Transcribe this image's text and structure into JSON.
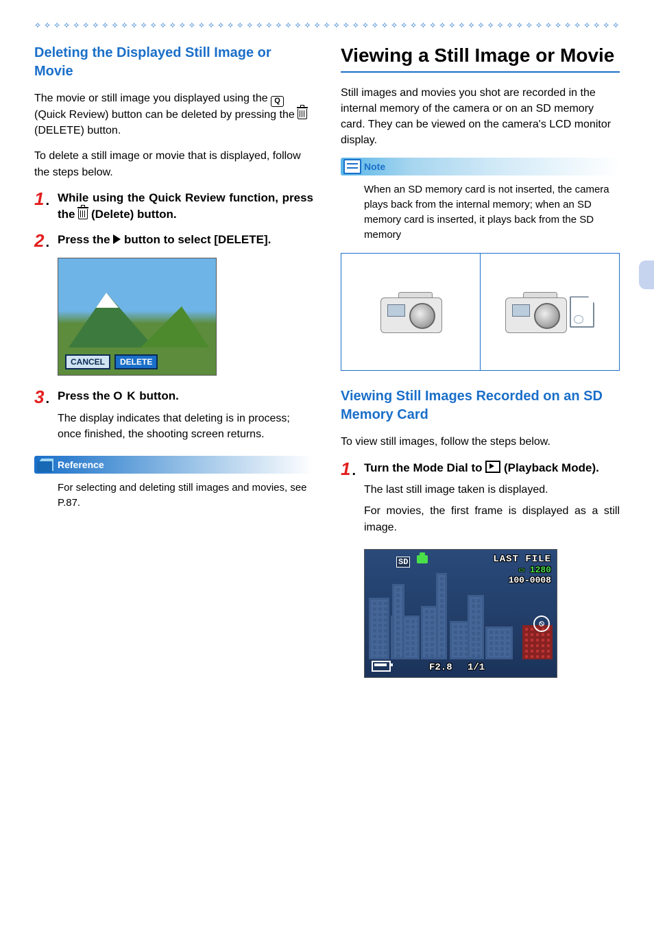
{
  "left": {
    "heading": "Deleting the Displayed Still Image or Movie",
    "intro1a": "The movie or still image you displayed using the ",
    "intro1b": " (Quick Review) button can be deleted by pressing the ",
    "intro1c": " (DELETE) button.",
    "intro2": "To delete a still image or movie that is displayed, follow the steps below.",
    "step1": {
      "num": "1",
      "a": "While using the Quick Review function, press the ",
      "b": " (Delete) button."
    },
    "step2": {
      "num": "2",
      "a": "Press the ",
      "b": " button to select [DELETE]."
    },
    "screen": {
      "cancel": "CANCEL",
      "delete": "DELETE"
    },
    "step3": {
      "num": "3",
      "a": "Press the ",
      "ok": "O K",
      "b": " button.",
      "sub": "The display indicates that deleting is in process; once finished, the shooting screen returns."
    },
    "reference": {
      "label": "Reference",
      "body": "For selecting and deleting still images and movies, see P.87."
    }
  },
  "right": {
    "heading": "Viewing a Still Image or Movie",
    "intro": "Still images and movies you shot are recorded in the internal memory of the camera or on an SD memory card. They can be viewed on the camera's LCD monitor display.",
    "note": {
      "label": "Note",
      "body": "When an SD memory card is not inserted, the camera plays back from the internal memory; when an SD memory card is inserted, it plays back from the SD memory"
    },
    "subheading": "Viewing Still Images Recorded on an SD Memory Card",
    "subintro": "To view still images, follow the steps below.",
    "step1": {
      "num": "1",
      "a": "Turn the Mode Dial to ",
      "b": " (Playback Mode).",
      "sub1": "The last still image taken is displayed.",
      "sub2": "For movies, the first frame is displayed as a still image."
    },
    "lcd": {
      "sd": "SD",
      "lastfile": "LAST FILE",
      "res_prefix": "▭",
      "res": "1280",
      "filenum": "100-0008",
      "aperture": "F2.8",
      "shutter": "1/1"
    }
  }
}
